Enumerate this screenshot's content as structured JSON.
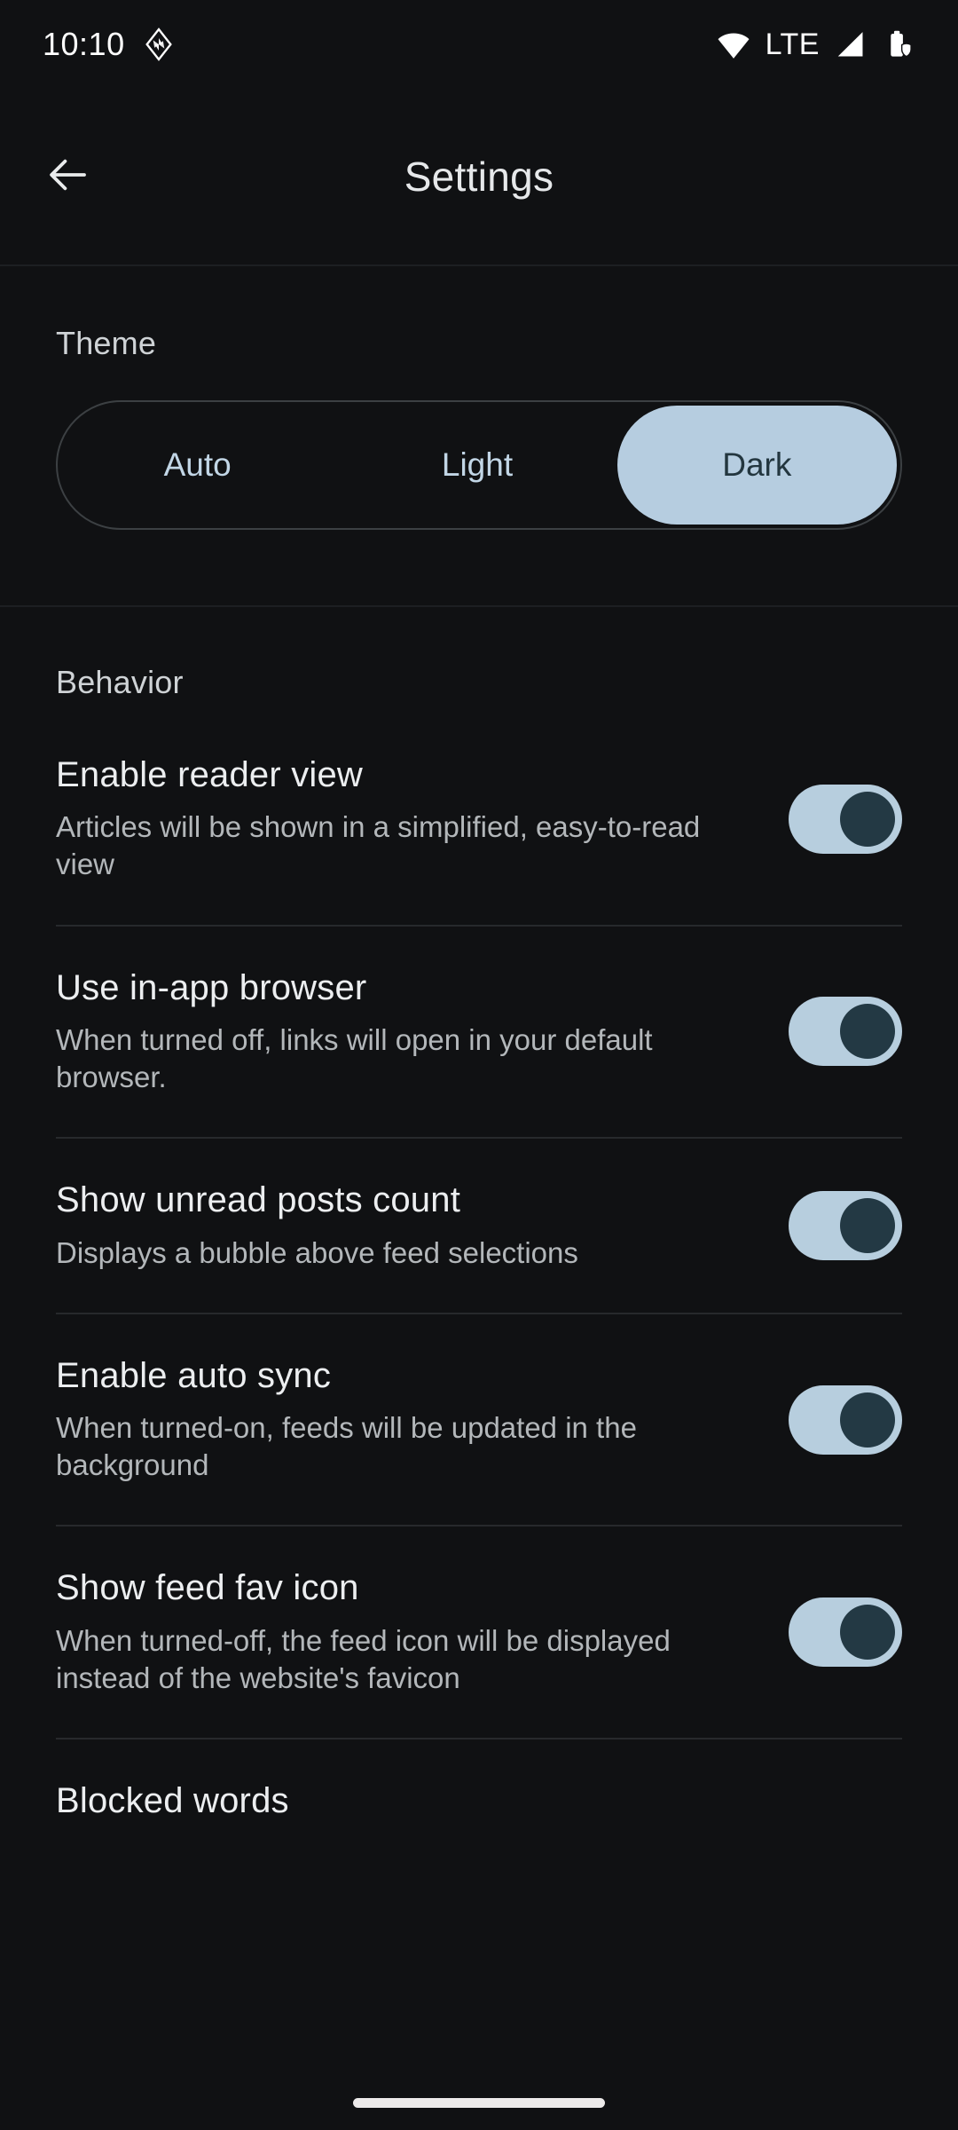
{
  "status_bar": {
    "time": "10:10",
    "app_icon": "diamond-app-icon",
    "network_label": "LTE",
    "icons": [
      "wifi-icon",
      "signal-icon",
      "battery-icon"
    ]
  },
  "app_bar": {
    "back_icon": "back-arrow-icon",
    "title": "Settings"
  },
  "theme_section": {
    "title": "Theme",
    "options": [
      {
        "label": "Auto",
        "selected": false
      },
      {
        "label": "Light",
        "selected": false
      },
      {
        "label": "Dark",
        "selected": true
      }
    ],
    "selected": "Dark"
  },
  "behavior_section": {
    "title": "Behavior",
    "items": [
      {
        "title": "Enable reader view",
        "subtitle": "Articles will be shown in a simplified, easy-to-read view",
        "toggle": "on"
      },
      {
        "title": "Use in-app browser",
        "subtitle": "When turned off, links will open in your default browser.",
        "toggle": "on"
      },
      {
        "title": "Show unread posts count",
        "subtitle": "Displays a bubble above feed selections",
        "toggle": "on"
      },
      {
        "title": "Enable auto sync",
        "subtitle": "When turned-on, feeds will be updated in the background",
        "toggle": "on"
      },
      {
        "title": "Show feed fav icon",
        "subtitle": "When turned-off, the feed icon will be displayed instead of the website's favicon",
        "toggle": "on"
      },
      {
        "title": "Blocked words",
        "subtitle": "",
        "toggle": "none"
      }
    ]
  },
  "colors": {
    "background": "#101113",
    "accent": "#b6cde0",
    "accent_on_text": "#23363f",
    "title_text": "#eceef0",
    "subtitle_text": "#b3b7ba",
    "divider": "#27292c"
  }
}
